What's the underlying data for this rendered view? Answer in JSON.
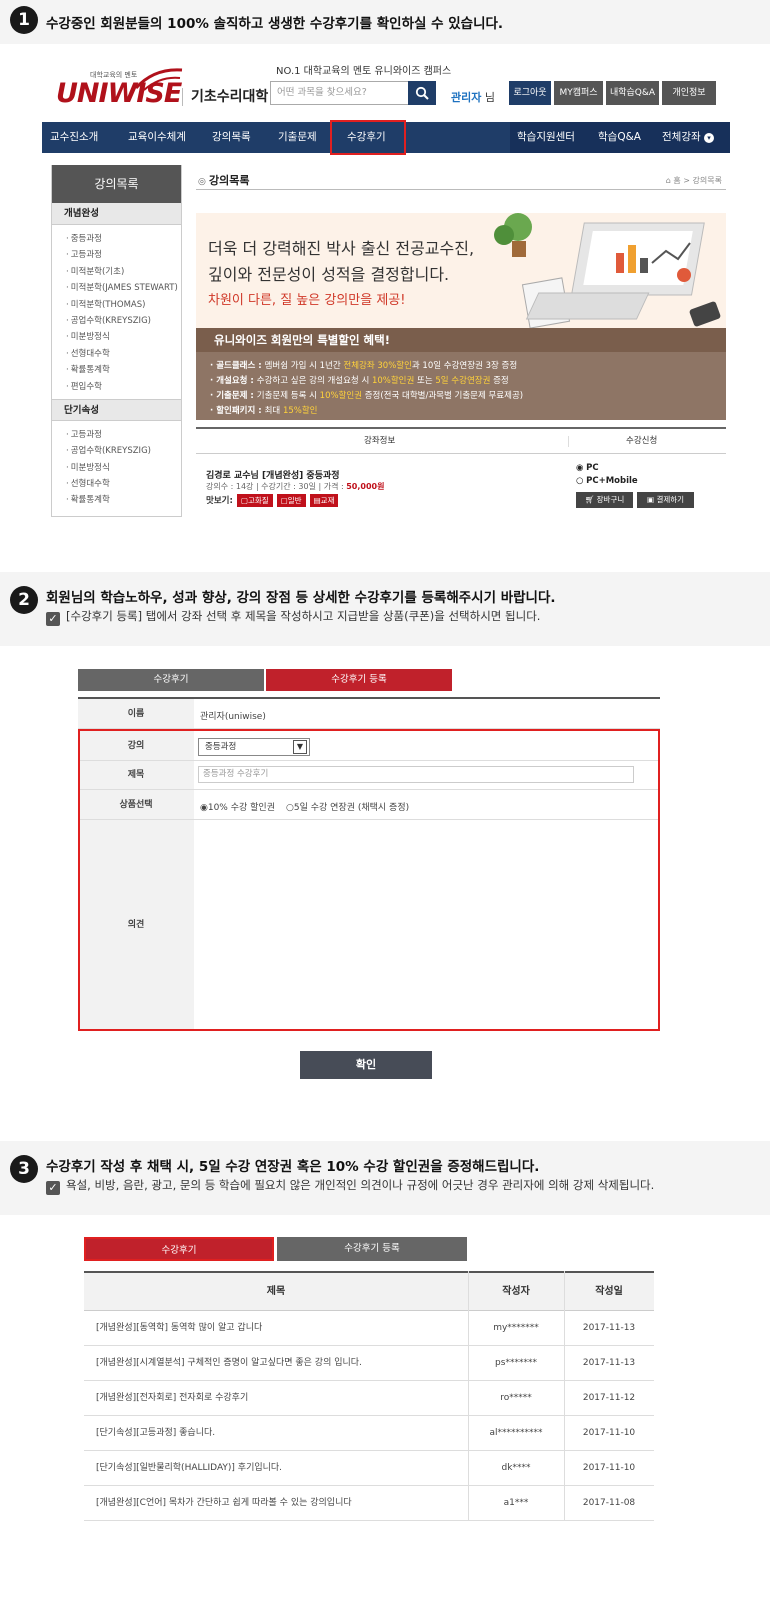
{
  "steps": [
    {
      "num": "1",
      "title": "수강중인 회원분들의 100% 솔직하고 생생한 수강후기를 확인하실 수 있습니다."
    },
    {
      "num": "2",
      "title": "회원님의 학습노하우, 성과 향상, 강의 장점 등 상세한 수강후기를 등록해주시기 바랍니다.",
      "sub": "[수강후기 등록] 탭에서 강좌 선택 후 제목을 작성하시고 지급받을 상품(쿠폰)을 선택하시면 됩니다."
    },
    {
      "num": "3",
      "title": "수강후기 작성 후 채택 시, 5일 수강 연장권 혹은 10% 수강 할인권을 증정해드립니다.",
      "sub": "욕설, 비방, 음란, 광고, 문의 등 학습에 필요치 않은 개인적인 의견이나 규정에 어긋난 경우 관리자에 의해 강제 삭제됩니다."
    }
  ],
  "header": {
    "logo_top": "대학교육의 멘토",
    "logo_main": "UNIWISE",
    "logo_sub": "기초수리대학",
    "tagline": "NO.1 대학교육의 멘토 유니와이즈 캠퍼스",
    "search_placeholder": "어떤 과목을 찾으세요?",
    "user_name": "관리자",
    "user_suffix": "님",
    "buttons": [
      "로그아웃",
      "MY캠퍼스",
      "내학습Q&A",
      "개인정보"
    ]
  },
  "nav": {
    "left": [
      "교수진소개",
      "교육이수체계",
      "강의목록",
      "기출문제",
      "수강후기"
    ],
    "right": [
      "학습지원센터",
      "학습Q&A",
      "전체강좌"
    ]
  },
  "sidebar": {
    "title": "강의목록",
    "cat1": "개념완성",
    "items1": [
      "중등과정",
      "고등과정",
      "미적분학(기초)",
      "미적분학(JAMES STEWART)",
      "미적분학(THOMAS)",
      "공업수학(KREYSZIG)",
      "미분방정식",
      "선형대수학",
      "확률통계학",
      "편입수학"
    ],
    "cat2": "단기속성",
    "items2": [
      "고등과정",
      "공업수학(KREYSZIG)",
      "미분방정식",
      "선형대수학",
      "확률통계학"
    ]
  },
  "content": {
    "title": "강의목록",
    "breadcrumb": "홈 > 강의목록",
    "banner": {
      "line1": "더욱 더 강력해진 박사 출신 전공교수진,",
      "line2": "깊이와 전문성이 성적을 결정합니다.",
      "line3": "차원이 다른, 질 높은 강의만을 제공!",
      "bar": "유니와이즈 회원만의 특별할인 혜택!",
      "benefits": [
        {
          "label": "· 골드클래스 : ",
          "a": "멤버쉽 가입 시 1년간 ",
          "b": "전체강좌 30%할인",
          "c": "과 10일 수강연장권 3장 증정"
        },
        {
          "label": "· 개설요청 : ",
          "a": "수강하고 싶은 강의 개설요청 시 ",
          "b": "10%할인권",
          "c": " 또는 ",
          "d": "5일 수강연장권",
          "e": " 증정"
        },
        {
          "label": "· 기출문제 : ",
          "a": "기출문제 등록 시 ",
          "b": "10%할인권",
          "c": " 증정(전국 대학별/과목별 기출문제 무료제공)"
        },
        {
          "label": "· 할인패키지 : ",
          "a": "최대 ",
          "b": "15%할인"
        }
      ]
    },
    "course": {
      "col_info": "강좌정보",
      "col_apply": "수강신청",
      "title": "김경로 교수님 [개념완성] 중등과정",
      "meta": "강의수 : 14강 | 수강기간 : 30일 | 가격 : ",
      "price": "50,000원",
      "preview_label": "맛보기:",
      "tags": [
        "고화질",
        "일반",
        "교재"
      ],
      "options": [
        "PC",
        "PC+Mobile"
      ],
      "cart": "장바구니",
      "pay": "결제하기"
    }
  },
  "form": {
    "tab_review": "수강후기",
    "tab_register": "수강후기 등록",
    "name_label": "이름",
    "name_value": "관리자(uniwise)",
    "course_label": "강의",
    "course_value": "중등과정",
    "title_label": "제목",
    "title_value": "중등과정 수강후기",
    "product_label": "상품선택",
    "product_opt1": "10% 수강 할인권",
    "product_opt2": "5일 수강 연장권  (채택시 증정)",
    "opinion_label": "의견",
    "confirm": "확인"
  },
  "reviews": {
    "tab_review": "수강후기",
    "tab_register": "수강후기 등록",
    "headers": [
      "제목",
      "작성자",
      "작성일"
    ],
    "rows": [
      {
        "title": "[개념완성][동역학] 동역학 많이 알고 갑니다",
        "author": "my*******",
        "date": "2017-11-13"
      },
      {
        "title": "[개념완성][시계열분석] 구체적인 증명이 알고싶다면 좋은 강의 입니다.",
        "author": "ps*******",
        "date": "2017-11-13"
      },
      {
        "title": "[개념완성][전자회로] 전자회로 수강후기",
        "author": "ro*****",
        "date": "2017-11-12"
      },
      {
        "title": "[단기속성][고등과정] 좋습니다.",
        "author": "al**********",
        "date": "2017-11-10"
      },
      {
        "title": "[단기속성][일반물리학(HALLIDAY)] 후기입니다.",
        "author": "dk****",
        "date": "2017-11-10"
      },
      {
        "title": "[개념완성][C언어] 목차가 간단하고 쉽게 따라볼 수 있는 강의입니다",
        "author": "a1***",
        "date": "2017-11-08"
      }
    ]
  },
  "colors": {
    "brand_red": "#b0111b",
    "navy": "#1f3d68",
    "highlight": "#e02020"
  }
}
